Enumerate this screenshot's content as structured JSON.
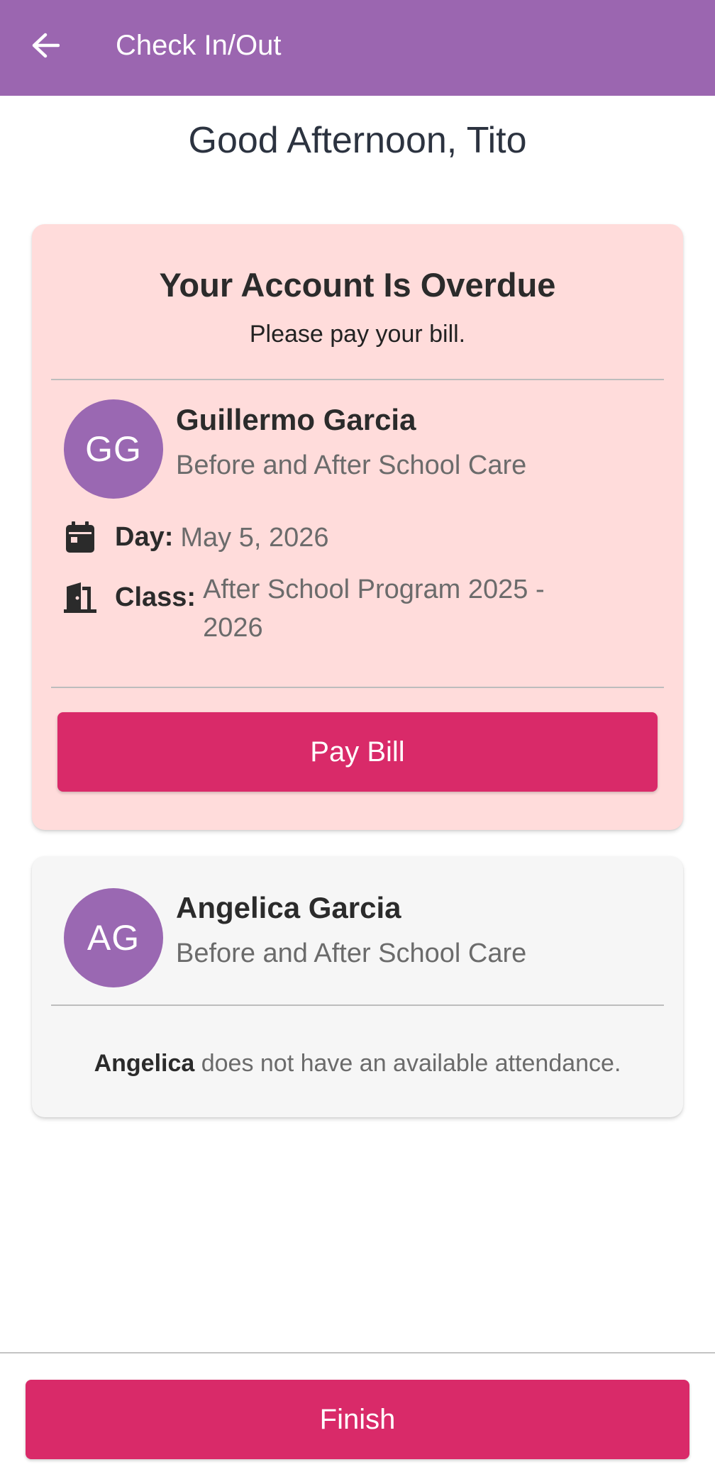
{
  "appbar": {
    "title": "Check In/Out",
    "back_icon": "arrow-left-icon",
    "color": "#9b66b0"
  },
  "greeting": "Good Afternoon, Tito",
  "overdue_card": {
    "title": "Your Account Is Overdue",
    "subtitle": "Please pay your bill.",
    "background": "#ffdcdb",
    "child": {
      "initials": "GG",
      "name": "Guillermo Garcia",
      "program": "Before and After School Care"
    },
    "day_label": "Day:",
    "day_value": "May 5, 2026",
    "class_label": "Class:",
    "class_value": "After School Program 2025 - 2026",
    "day_icon": "calendar-icon",
    "class_icon": "door-icon",
    "pay_button": "Pay Bill"
  },
  "second_card": {
    "child": {
      "initials": "AG",
      "name": "Angelica Garcia",
      "program": "Before and After School Care"
    },
    "note_name": "Angelica",
    "note_text": " does not have an available attendance."
  },
  "finish_button": "Finish",
  "colors": {
    "accent": "#d92a69",
    "avatar": "#9a68b2"
  }
}
